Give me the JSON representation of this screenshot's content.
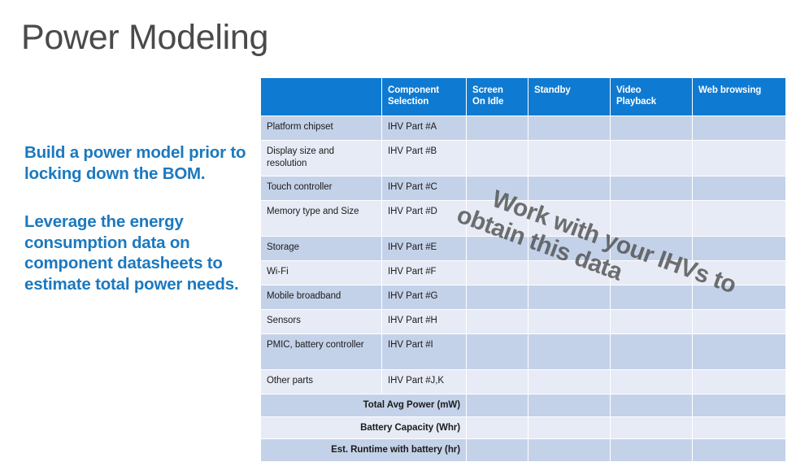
{
  "slide": {
    "title": "Power Modeling"
  },
  "left_panel": {
    "bullets": [
      "Build a power model prior to locking down the BOM.",
      "Leverage the energy consumption data on component datasheets to estimate total power needs."
    ]
  },
  "watermark": {
    "line1": "Work with your IHVs to",
    "line2": "obtain this data",
    "full_text": "Work with your IHVs to obtain this data",
    "rotation_deg": 20,
    "color": "#4e4e4e"
  },
  "table": {
    "headers": [
      "",
      "Component Selection",
      "Screen On Idle",
      "Standby",
      "Video Playback",
      "Web browsing"
    ],
    "header_lines": {
      "col0": [
        "",
        ""
      ],
      "col1": [
        "Component",
        "Selection"
      ],
      "col2": [
        "Screen",
        "On Idle"
      ],
      "col3": [
        "Standby",
        ""
      ],
      "col4": [
        "Video",
        "Playback"
      ],
      "col5": [
        "Web browsing",
        ""
      ]
    },
    "rows": [
      {
        "component": "Platform chipset",
        "selection": "IHV Part #A",
        "screen_on_idle": "",
        "standby": "",
        "video_playback": "",
        "web_browsing": ""
      },
      {
        "component": "Display size and resolution",
        "selection": "IHV Part #B",
        "screen_on_idle": "",
        "standby": "",
        "video_playback": "",
        "web_browsing": ""
      },
      {
        "component": "Touch controller",
        "selection": "IHV Part #C",
        "screen_on_idle": "",
        "standby": "",
        "video_playback": "",
        "web_browsing": ""
      },
      {
        "component": "Memory type and Size",
        "selection": "IHV Part #D",
        "screen_on_idle": "",
        "standby": "",
        "video_playback": "",
        "web_browsing": ""
      },
      {
        "component": "Storage",
        "selection": "IHV Part #E",
        "screen_on_idle": "",
        "standby": "",
        "video_playback": "",
        "web_browsing": ""
      },
      {
        "component": "Wi-Fi",
        "selection": "IHV Part #F",
        "screen_on_idle": "",
        "standby": "",
        "video_playback": "",
        "web_browsing": ""
      },
      {
        "component": "Mobile broadband",
        "selection": "IHV Part #G",
        "screen_on_idle": "",
        "standby": "",
        "video_playback": "",
        "web_browsing": ""
      },
      {
        "component": "Sensors",
        "selection": "IHV Part #H",
        "screen_on_idle": "",
        "standby": "",
        "video_playback": "",
        "web_browsing": ""
      },
      {
        "component": "PMIC, battery controller",
        "selection": "IHV Part #I",
        "screen_on_idle": "",
        "standby": "",
        "video_playback": "",
        "web_browsing": ""
      },
      {
        "component": "Other parts",
        "selection": "IHV Part #J,K",
        "screen_on_idle": "",
        "standby": "",
        "video_playback": "",
        "web_browsing": ""
      }
    ],
    "summary_rows": [
      {
        "label": "Total Avg Power (mW)",
        "screen_on_idle": "",
        "standby": "",
        "video_playback": "",
        "web_browsing": ""
      },
      {
        "label": "Battery Capacity (Whr)",
        "screen_on_idle": "",
        "standby": "",
        "video_playback": "",
        "web_browsing": ""
      },
      {
        "label": "Est. Runtime with battery (hr)",
        "screen_on_idle": "",
        "standby": "",
        "video_playback": "",
        "web_browsing": ""
      }
    ],
    "colors": {
      "header_blue": "#0f7ad1",
      "band_a": "#c4d2e9",
      "band_b": "#e6ebf6",
      "text": "#1b1b1b"
    }
  }
}
